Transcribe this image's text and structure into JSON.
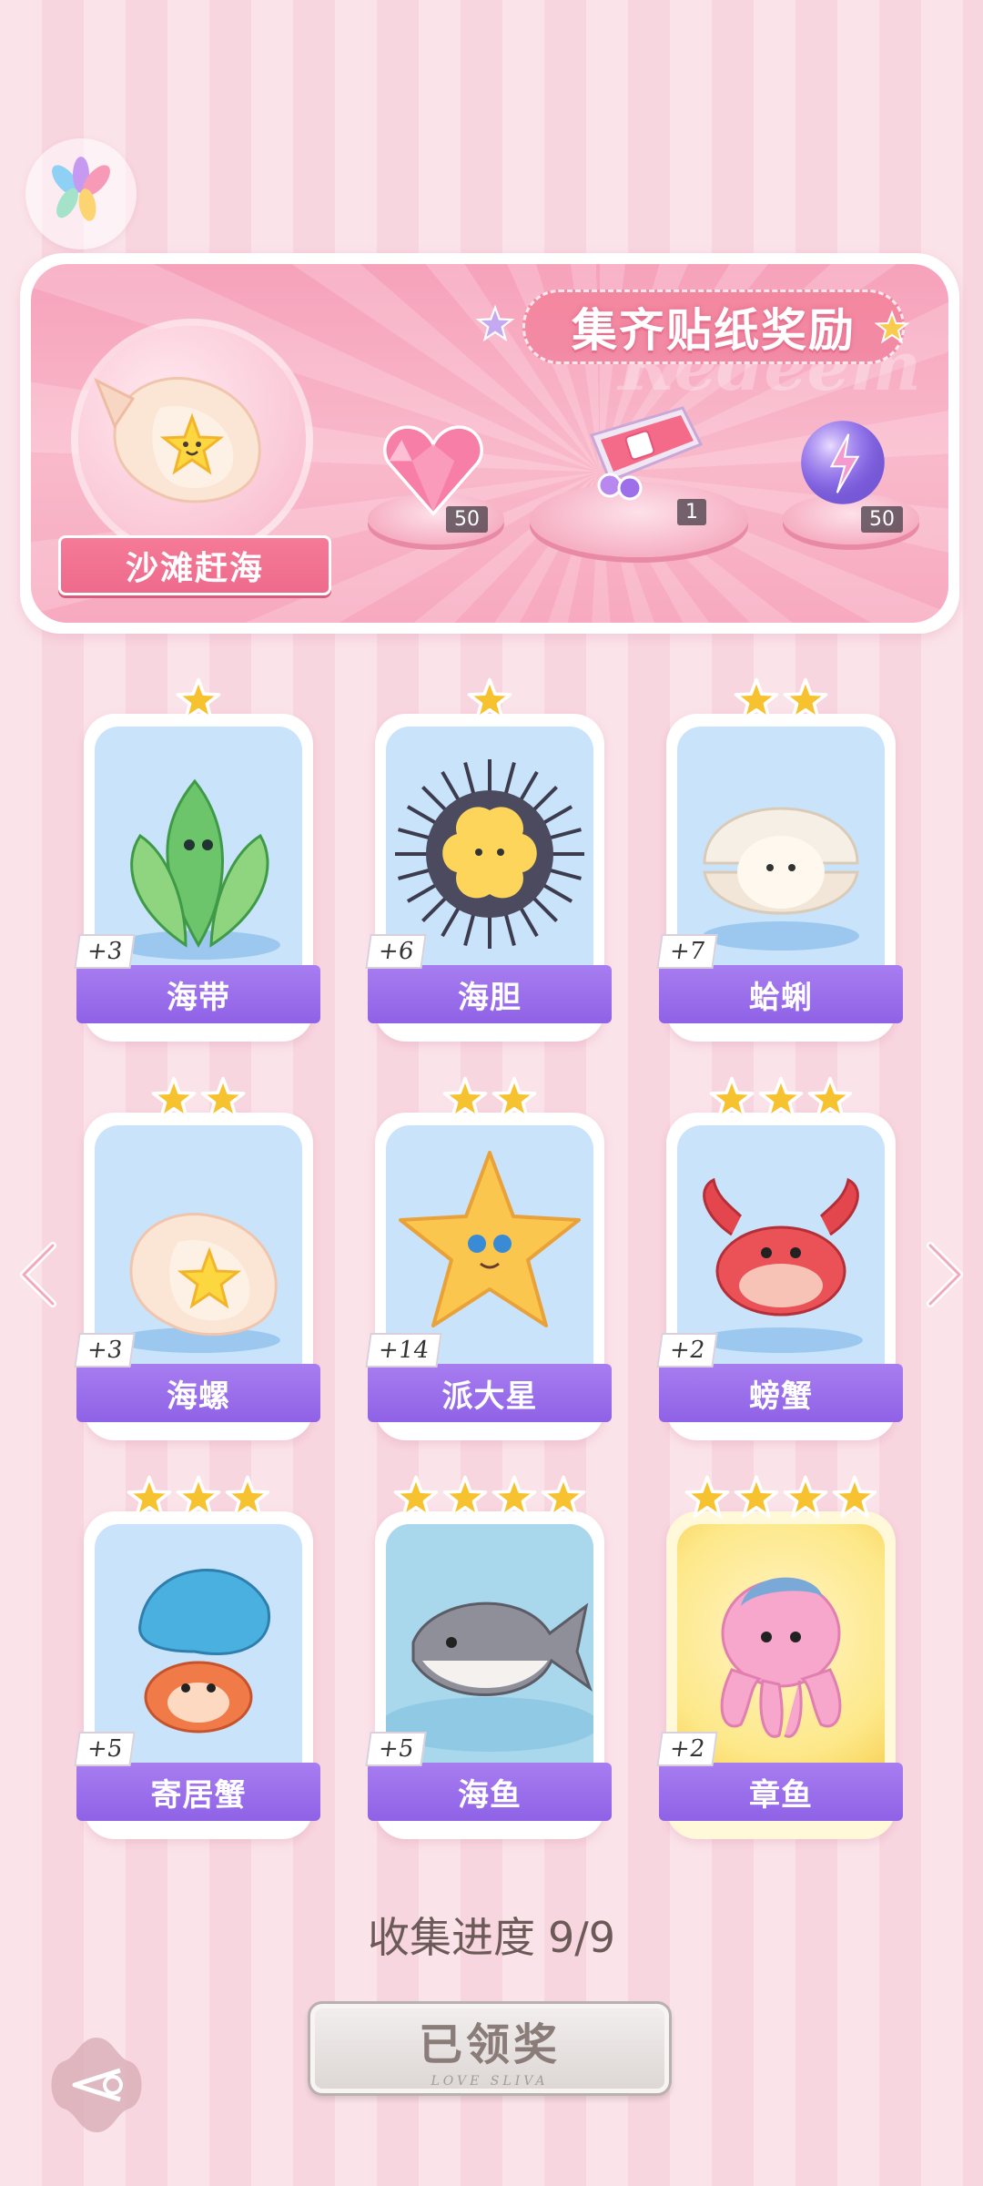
{
  "banner": {
    "title": "集齐贴纸奖励",
    "watermark": "Redeem",
    "theme_name": "沙滩赶海",
    "rewards": [
      {
        "icon": "heart-gem-icon",
        "count": "50"
      },
      {
        "icon": "gift-pack-icon",
        "count": "1"
      },
      {
        "icon": "lightning-orb-icon",
        "count": "50"
      }
    ]
  },
  "stickers": [
    {
      "name": "海带",
      "count": "+3",
      "stars": 1,
      "icon": "kelp-icon"
    },
    {
      "name": "海胆",
      "count": "+6",
      "stars": 1,
      "icon": "sea-urchin-icon"
    },
    {
      "name": "蛤蜊",
      "count": "+7",
      "stars": 2,
      "icon": "clam-icon"
    },
    {
      "name": "海螺",
      "count": "+3",
      "stars": 2,
      "icon": "conch-icon"
    },
    {
      "name": "派大星",
      "count": "+14",
      "stars": 2,
      "icon": "starfish-icon"
    },
    {
      "name": "螃蟹",
      "count": "+2",
      "stars": 3,
      "icon": "crab-icon"
    },
    {
      "name": "寄居蟹",
      "count": "+5",
      "stars": 3,
      "icon": "hermit-crab-icon"
    },
    {
      "name": "海鱼",
      "count": "+5",
      "stars": 4,
      "icon": "fish-icon"
    },
    {
      "name": "章鱼",
      "count": "+2",
      "stars": 4,
      "icon": "octopus-icon"
    }
  ],
  "progress": {
    "label": "收集进度",
    "value": "9/9"
  },
  "claim_button": {
    "label": "已领奖",
    "sub": "LOVE SLIVA"
  },
  "colors": {
    "label_purple": "#9a6eea",
    "banner_pink": "#f6a2bb",
    "star_gold": "#f7c22f"
  }
}
